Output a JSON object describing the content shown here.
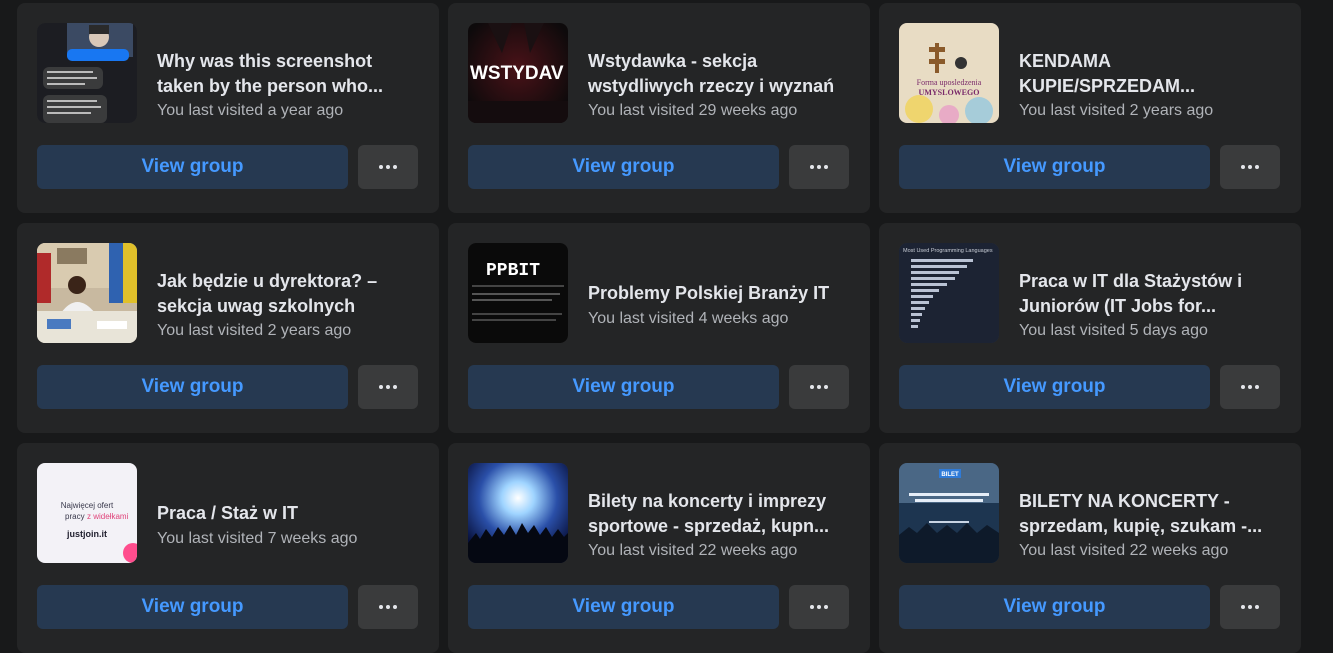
{
  "groups": [
    {
      "name": "Why was this screenshot taken by the person who...",
      "visited": "You last visited a year ago",
      "view_label": "View group",
      "thumb_text": "",
      "icon": "more-options-icon"
    },
    {
      "name": "Wstydawka - sekcja wstydliwych rzeczy i wyznań",
      "visited": "You last visited 29 weeks ago",
      "view_label": "View group",
      "thumb_text": "WSTYDAV",
      "icon": "more-options-icon"
    },
    {
      "name": "KENDAMA KUPIE/SPRZEDAM...",
      "visited": "You last visited 2 years ago",
      "view_label": "View group",
      "thumb_text": "Forma uposledzenia UMYSLOWEGO",
      "icon": "more-options-icon"
    },
    {
      "name": "Jak będzie u dyrektora? – sekcja uwag szkolnych",
      "visited": "You last visited 2 years ago",
      "view_label": "View group",
      "thumb_text": "",
      "icon": "more-options-icon"
    },
    {
      "name": "Problemy Polskiej Branży IT",
      "visited": "You last visited 4 weeks ago",
      "view_label": "View group",
      "thumb_text": "PPBIT",
      "icon": "more-options-icon"
    },
    {
      "name": "Praca w IT dla Stażystów i Juniorów (IT Jobs for...",
      "visited": "You last visited 5 days ago",
      "view_label": "View group",
      "thumb_text": "Most Used Programming Languages",
      "icon": "more-options-icon"
    },
    {
      "name": "Praca / Staż w IT",
      "visited": "You last visited 7 weeks ago",
      "view_label": "View group",
      "thumb_text": "Najwięcej ofert pracy z widełkami justjoin.it",
      "icon": "more-options-icon"
    },
    {
      "name": "Bilety na koncerty i imprezy sportowe - sprzedaż, kupn...",
      "visited": "You last visited 22 weeks ago",
      "view_label": "View group",
      "thumb_text": "",
      "icon": "more-options-icon"
    },
    {
      "name": "BILETY NA KONCERTY - sprzedam, kupię, szukam -...",
      "visited": "You last visited 22 weeks ago",
      "view_label": "View group",
      "thumb_text": "BILET",
      "icon": "more-options-icon"
    }
  ],
  "colors": {
    "page_bg": "#18191a",
    "card_bg": "#242526",
    "view_button_bg": "#263951",
    "view_button_text": "#4599ff",
    "more_button_bg": "#3a3b3c"
  }
}
